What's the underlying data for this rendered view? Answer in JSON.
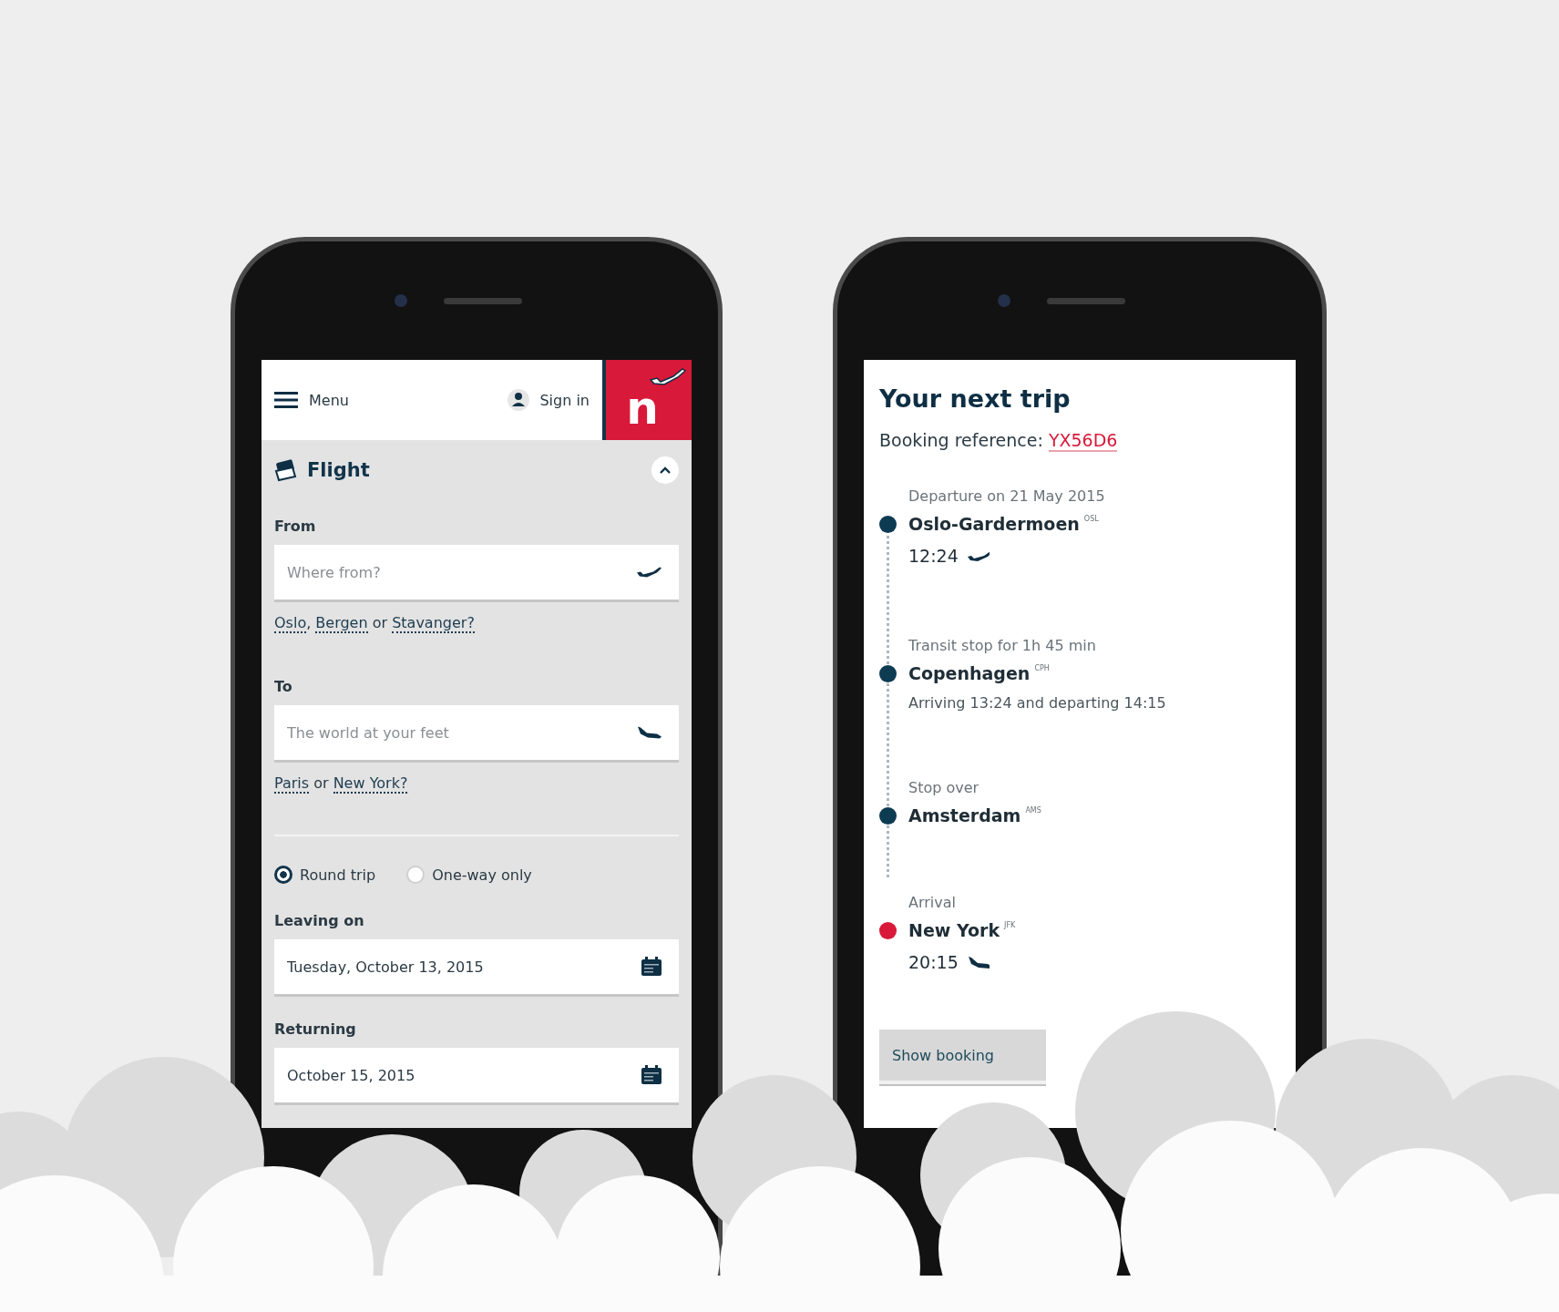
{
  "left_screen": {
    "header": {
      "menu_label": "Menu",
      "sign_in_label": "Sign in",
      "logo_text": "n"
    },
    "flight_section": {
      "title": "Flight",
      "expanded": true
    },
    "airport_fields": [
      {
        "kind": "from",
        "label": "From",
        "placeholder": "Where from?",
        "suggestion": {
          "links": [
            "Oslo",
            "Bergen",
            "Stavanger?"
          ],
          "separators": [
            ", ",
            " or "
          ]
        }
      },
      {
        "kind": "to",
        "label": "To",
        "placeholder": "The world at your feet",
        "suggestion": {
          "links": [
            "Paris",
            "New York?"
          ],
          "separators": [
            " or "
          ]
        }
      }
    ],
    "trip_types": [
      {
        "label": "Round trip",
        "selected": true
      },
      {
        "label": "One-way only",
        "selected": false
      }
    ],
    "date_fields": [
      {
        "label": "Leaving on",
        "value": "Tuesday, October 13, 2015"
      },
      {
        "label": "Returning",
        "value": "October 15, 2015"
      }
    ]
  },
  "right_screen": {
    "title": "Your next trip",
    "booking_label": "Booking reference: ",
    "booking_reference": "YX56D6",
    "stops": [
      {
        "kind": "departure",
        "caption": "Departure on 21 May 2015",
        "name": "Oslo-Gardermoen",
        "code": "OSL",
        "time": "12:24",
        "color": "#0d3b52"
      },
      {
        "kind": "transit",
        "caption": "Transit stop for 1h 45 min",
        "name": "Copenhagen",
        "code": "CPH",
        "detail": "Arriving 13:24 and departing 14:15",
        "color": "#0d3b52"
      },
      {
        "kind": "stopover",
        "caption": "Stop over",
        "name": "Amsterdam",
        "code": "AMS",
        "color": "#0d3b52"
      },
      {
        "kind": "arrival",
        "caption": "Arrival",
        "name": "New York",
        "code": "JFK",
        "time": "20:15",
        "color": "#d81939"
      }
    ],
    "button_label": "Show booking"
  }
}
